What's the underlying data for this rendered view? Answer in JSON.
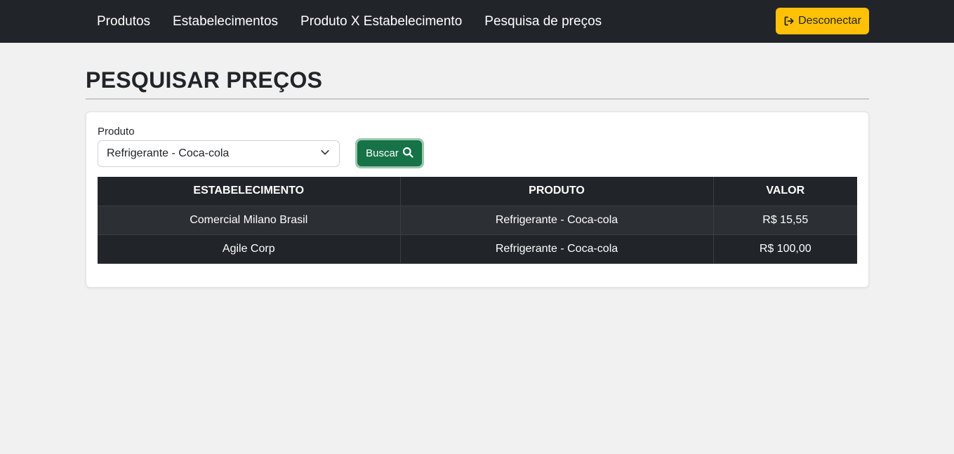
{
  "navbar": {
    "links": [
      "Produtos",
      "Estabelecimentos",
      "Produto X Estabelecimento",
      "Pesquisa de preços"
    ],
    "logout_label": "Desconectar",
    "logout_icon": "sign-out-icon"
  },
  "page": {
    "title": "PESQUISAR PREÇOS"
  },
  "form": {
    "product_label": "Produto",
    "product_selected": "Refrigerante - Coca-cola",
    "search_label": "Buscar",
    "search_icon": "search-icon"
  },
  "table": {
    "headers": [
      "ESTABELECIMENTO",
      "PRODUTO",
      "VALOR"
    ],
    "rows": [
      [
        "Comercial Milano Brasil",
        "Refrigerante - Coca-cola",
        "R$ 15,55"
      ],
      [
        "Agile Corp",
        "Refrigerante - Coca-cola",
        "R$ 100,00"
      ]
    ]
  },
  "colors": {
    "navbar_bg": "#212529",
    "logout_btn": "#ffc107",
    "search_btn": "#157347",
    "page_bg": "#f1f1f1"
  }
}
